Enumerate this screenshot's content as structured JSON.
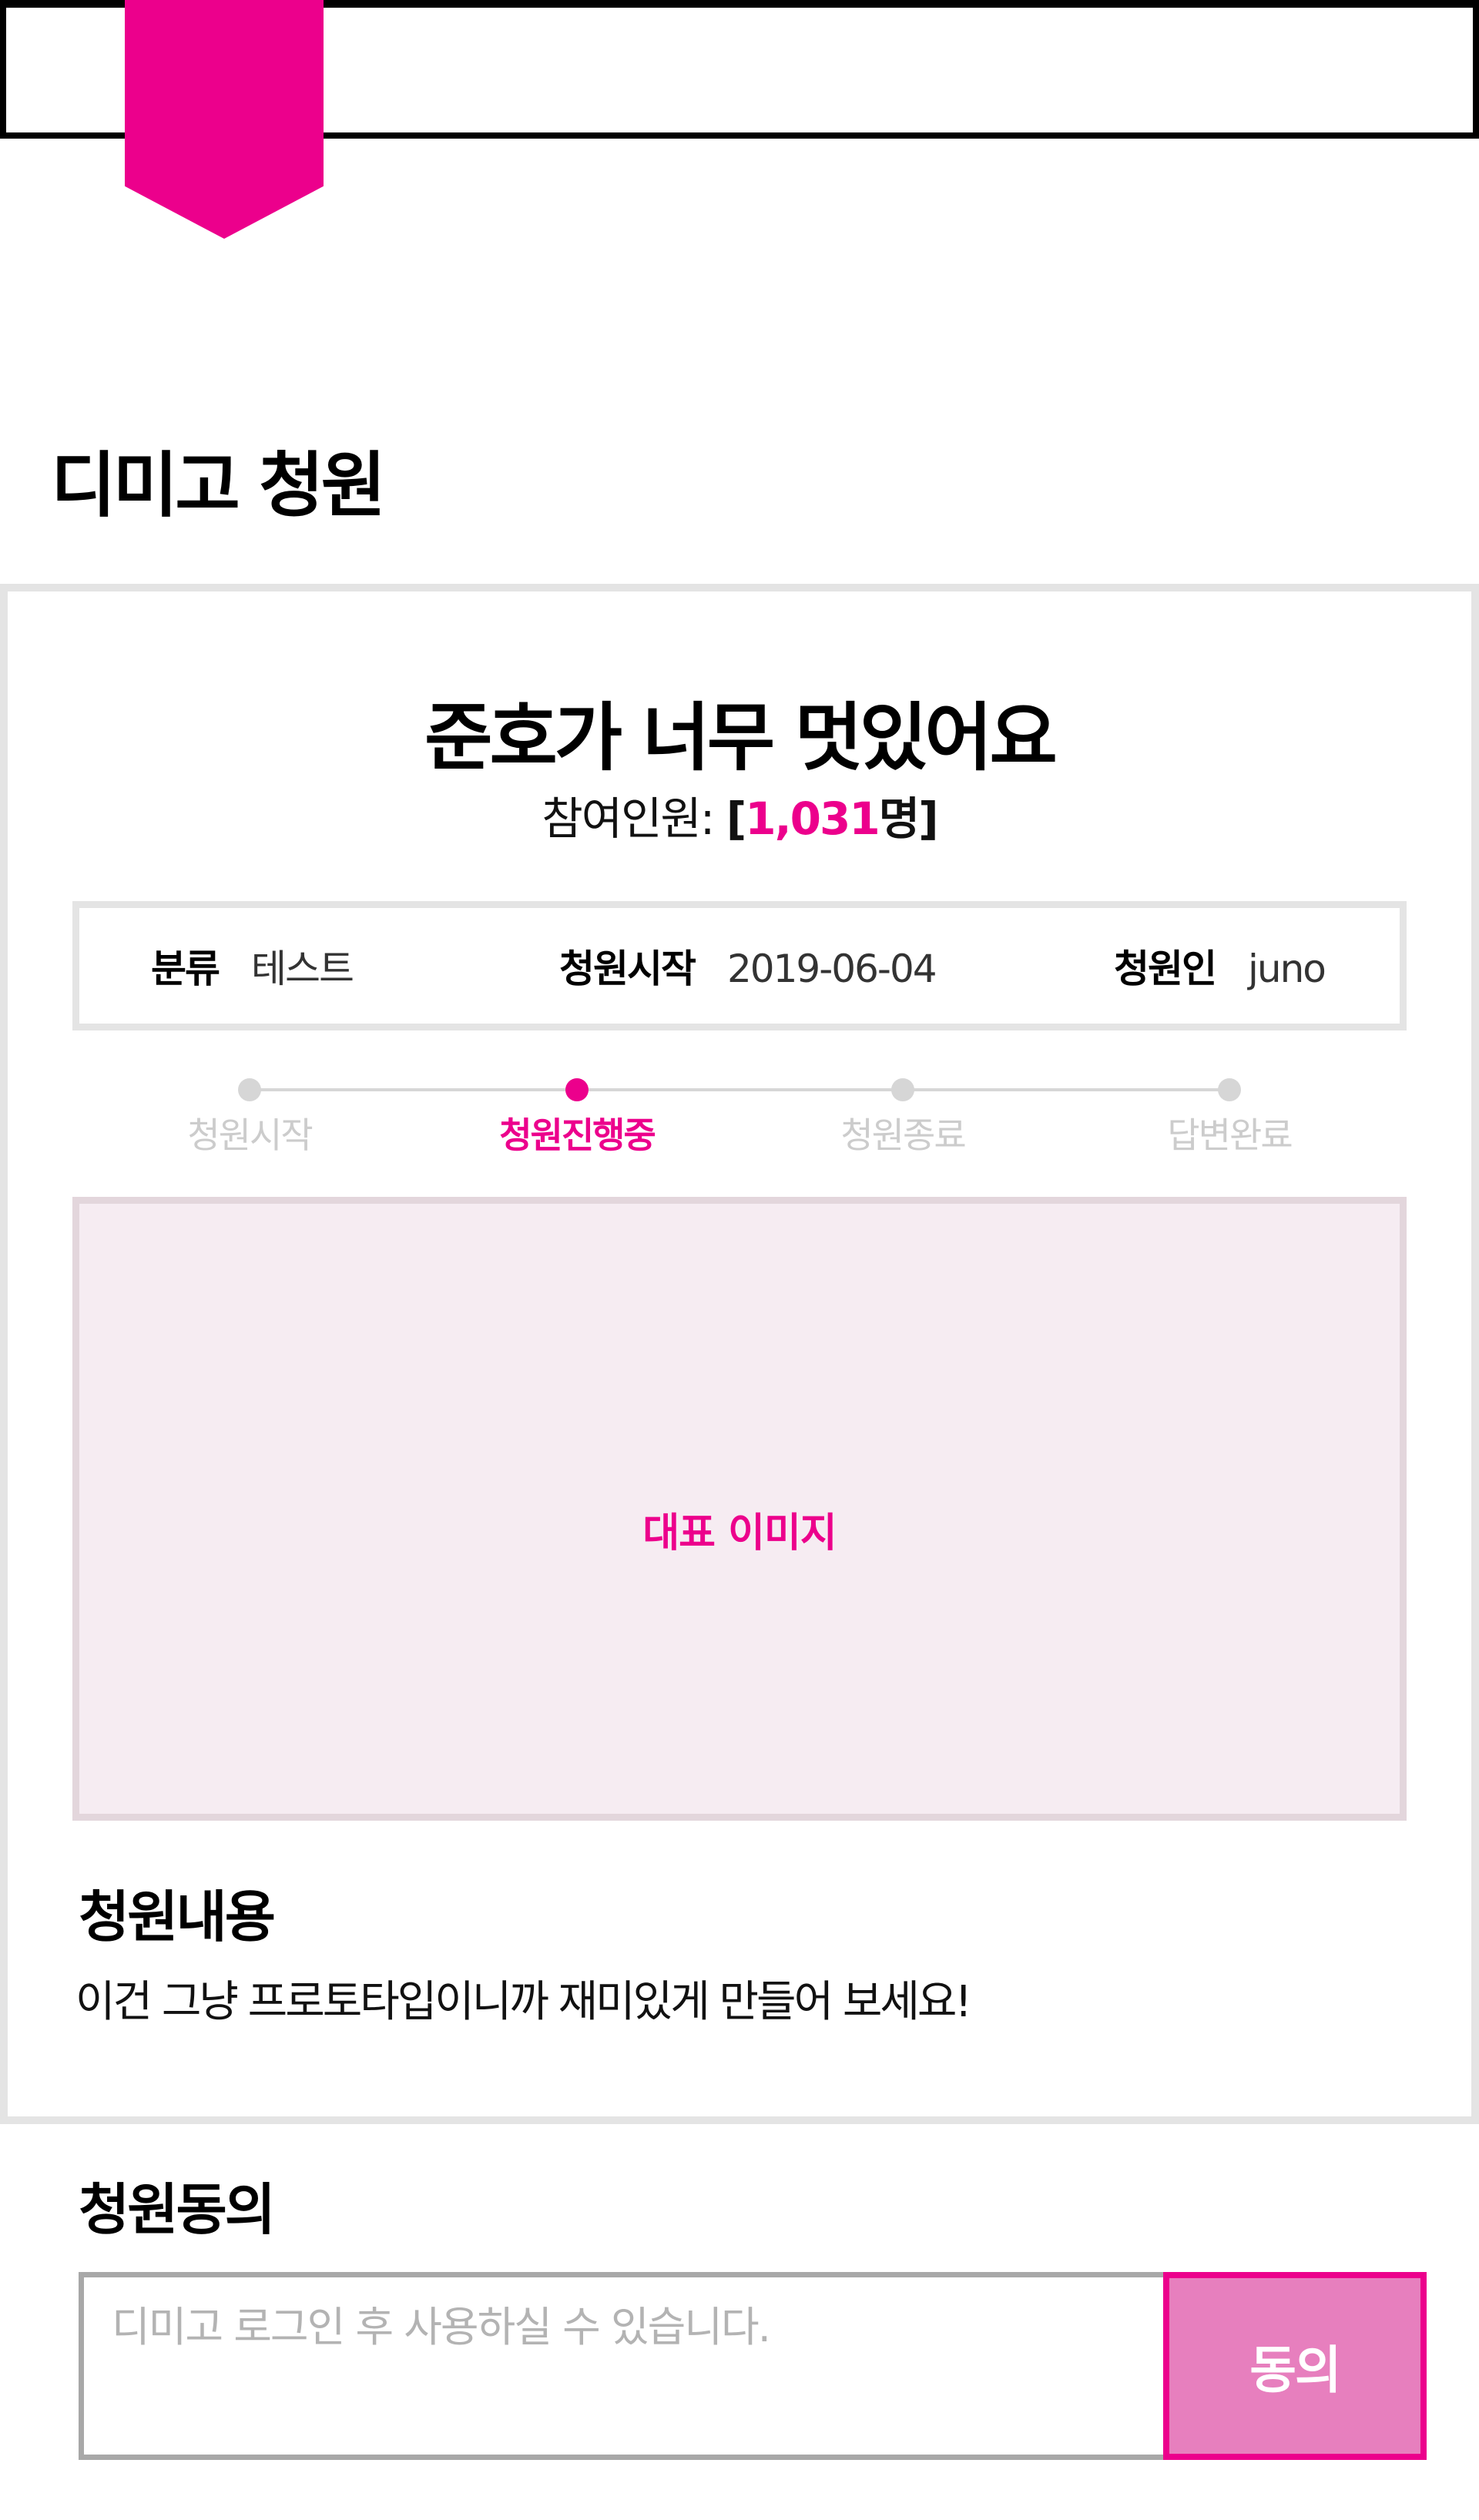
{
  "page_title": "디미고 청원",
  "petition": {
    "title": "준호가 너무 멋있어요",
    "participants_label": "참여인원: ",
    "open_bracket": "[",
    "participants_count": "1,031",
    "participants_unit": "명",
    "close_bracket": "]"
  },
  "info": {
    "category_label": "분류",
    "category_value": "테스트",
    "start_label": "청원시작",
    "start_value": "2019-06-04",
    "author_label": "청원인",
    "author_value": "juno"
  },
  "steps": [
    {
      "label": "청원시작",
      "active": false
    },
    {
      "label": "청원진행중",
      "active": true
    },
    {
      "label": "청원종료",
      "active": false
    },
    {
      "label": "답변완료",
      "active": false
    }
  ],
  "image_placeholder": "대표 이미지",
  "content": {
    "title": "청원내용",
    "text": "이건 그냥 프로토타입이니까 재미있게 만들어 보세요!"
  },
  "agree": {
    "title": "청원동의",
    "placeholder": "디미고 로그인 후 사용하실 수 있습니다.",
    "button_label": "동의"
  },
  "colors": {
    "accent": "#ec008c",
    "button_fill": "#e77fbe",
    "image_bg": "#f6ecf2",
    "border": "#e4e4e4"
  }
}
